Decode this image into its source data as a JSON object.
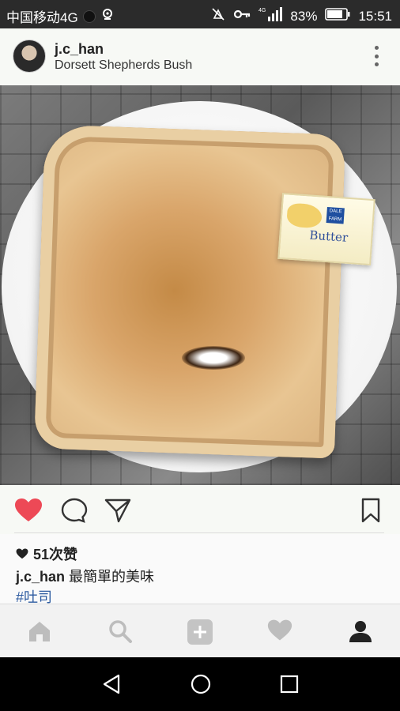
{
  "status_bar": {
    "carrier": "中国移动4G",
    "network": "4G",
    "battery": "83%",
    "time": "15:51"
  },
  "post": {
    "username": "j.c_han",
    "location": "Dorsett Shepherds Bush",
    "photo": {
      "butter_brand": "DALE FARM",
      "butter_label": "Butter"
    },
    "likes": "51次赞",
    "caption_user": "j.c_han",
    "caption_text": "最簡單的美味",
    "hashtag": "#吐司"
  },
  "colors": {
    "like_red": "#ed4956",
    "hashtag_blue": "#2c5aa0"
  },
  "icons": {
    "actions": [
      "heart-filled-icon",
      "comment-icon",
      "share-icon",
      "bookmark-icon"
    ],
    "tabs": [
      "home-icon",
      "search-icon",
      "add-icon",
      "activity-icon",
      "profile-icon"
    ],
    "android_nav": [
      "back-icon",
      "home-circle-icon",
      "recents-icon"
    ]
  }
}
